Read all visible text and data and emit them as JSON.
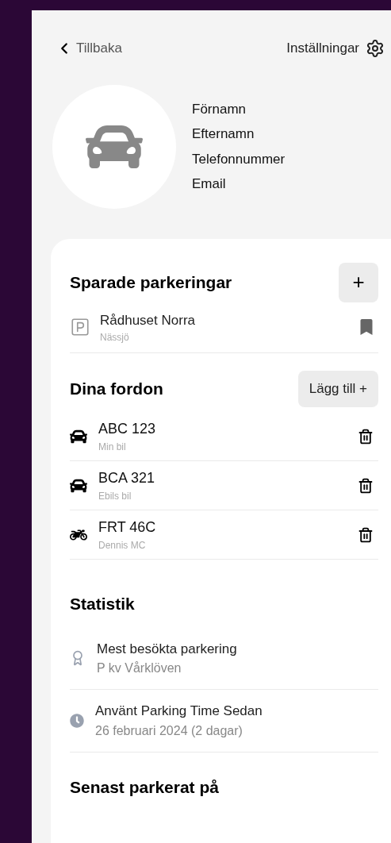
{
  "header": {
    "back": "Tillbaka",
    "settings": "Inställningar"
  },
  "profile": {
    "fields": [
      "Förnamn",
      "Efternamn",
      "Telefonnummer",
      "Email"
    ]
  },
  "saved_parkings": {
    "title": "Sparade parkeringar",
    "add_button": "+",
    "items": [
      {
        "name": "Rådhuset Norra",
        "city": "Nässjö",
        "bookmarked": true
      }
    ]
  },
  "vehicles": {
    "title": "Dina fordon",
    "add_button": "Lägg till +",
    "items": [
      {
        "kind": "car",
        "plate": "ABC 123",
        "label": "Min bil"
      },
      {
        "kind": "car",
        "plate": "BCA 321",
        "label": "Ebils bil"
      },
      {
        "kind": "motorcycle",
        "plate": "FRT 46C",
        "label": "Dennis MC"
      }
    ]
  },
  "statistics": {
    "title": "Statistik",
    "items": [
      {
        "kind": "award",
        "label": "Mest besökta parkering",
        "value": "P kv Vårklöven"
      },
      {
        "kind": "clock",
        "label": "Använt Parking Time Sedan",
        "value": "26 februari 2024 (2 dagar)"
      }
    ]
  },
  "last_parked": {
    "title": "Senast parkerat på"
  }
}
